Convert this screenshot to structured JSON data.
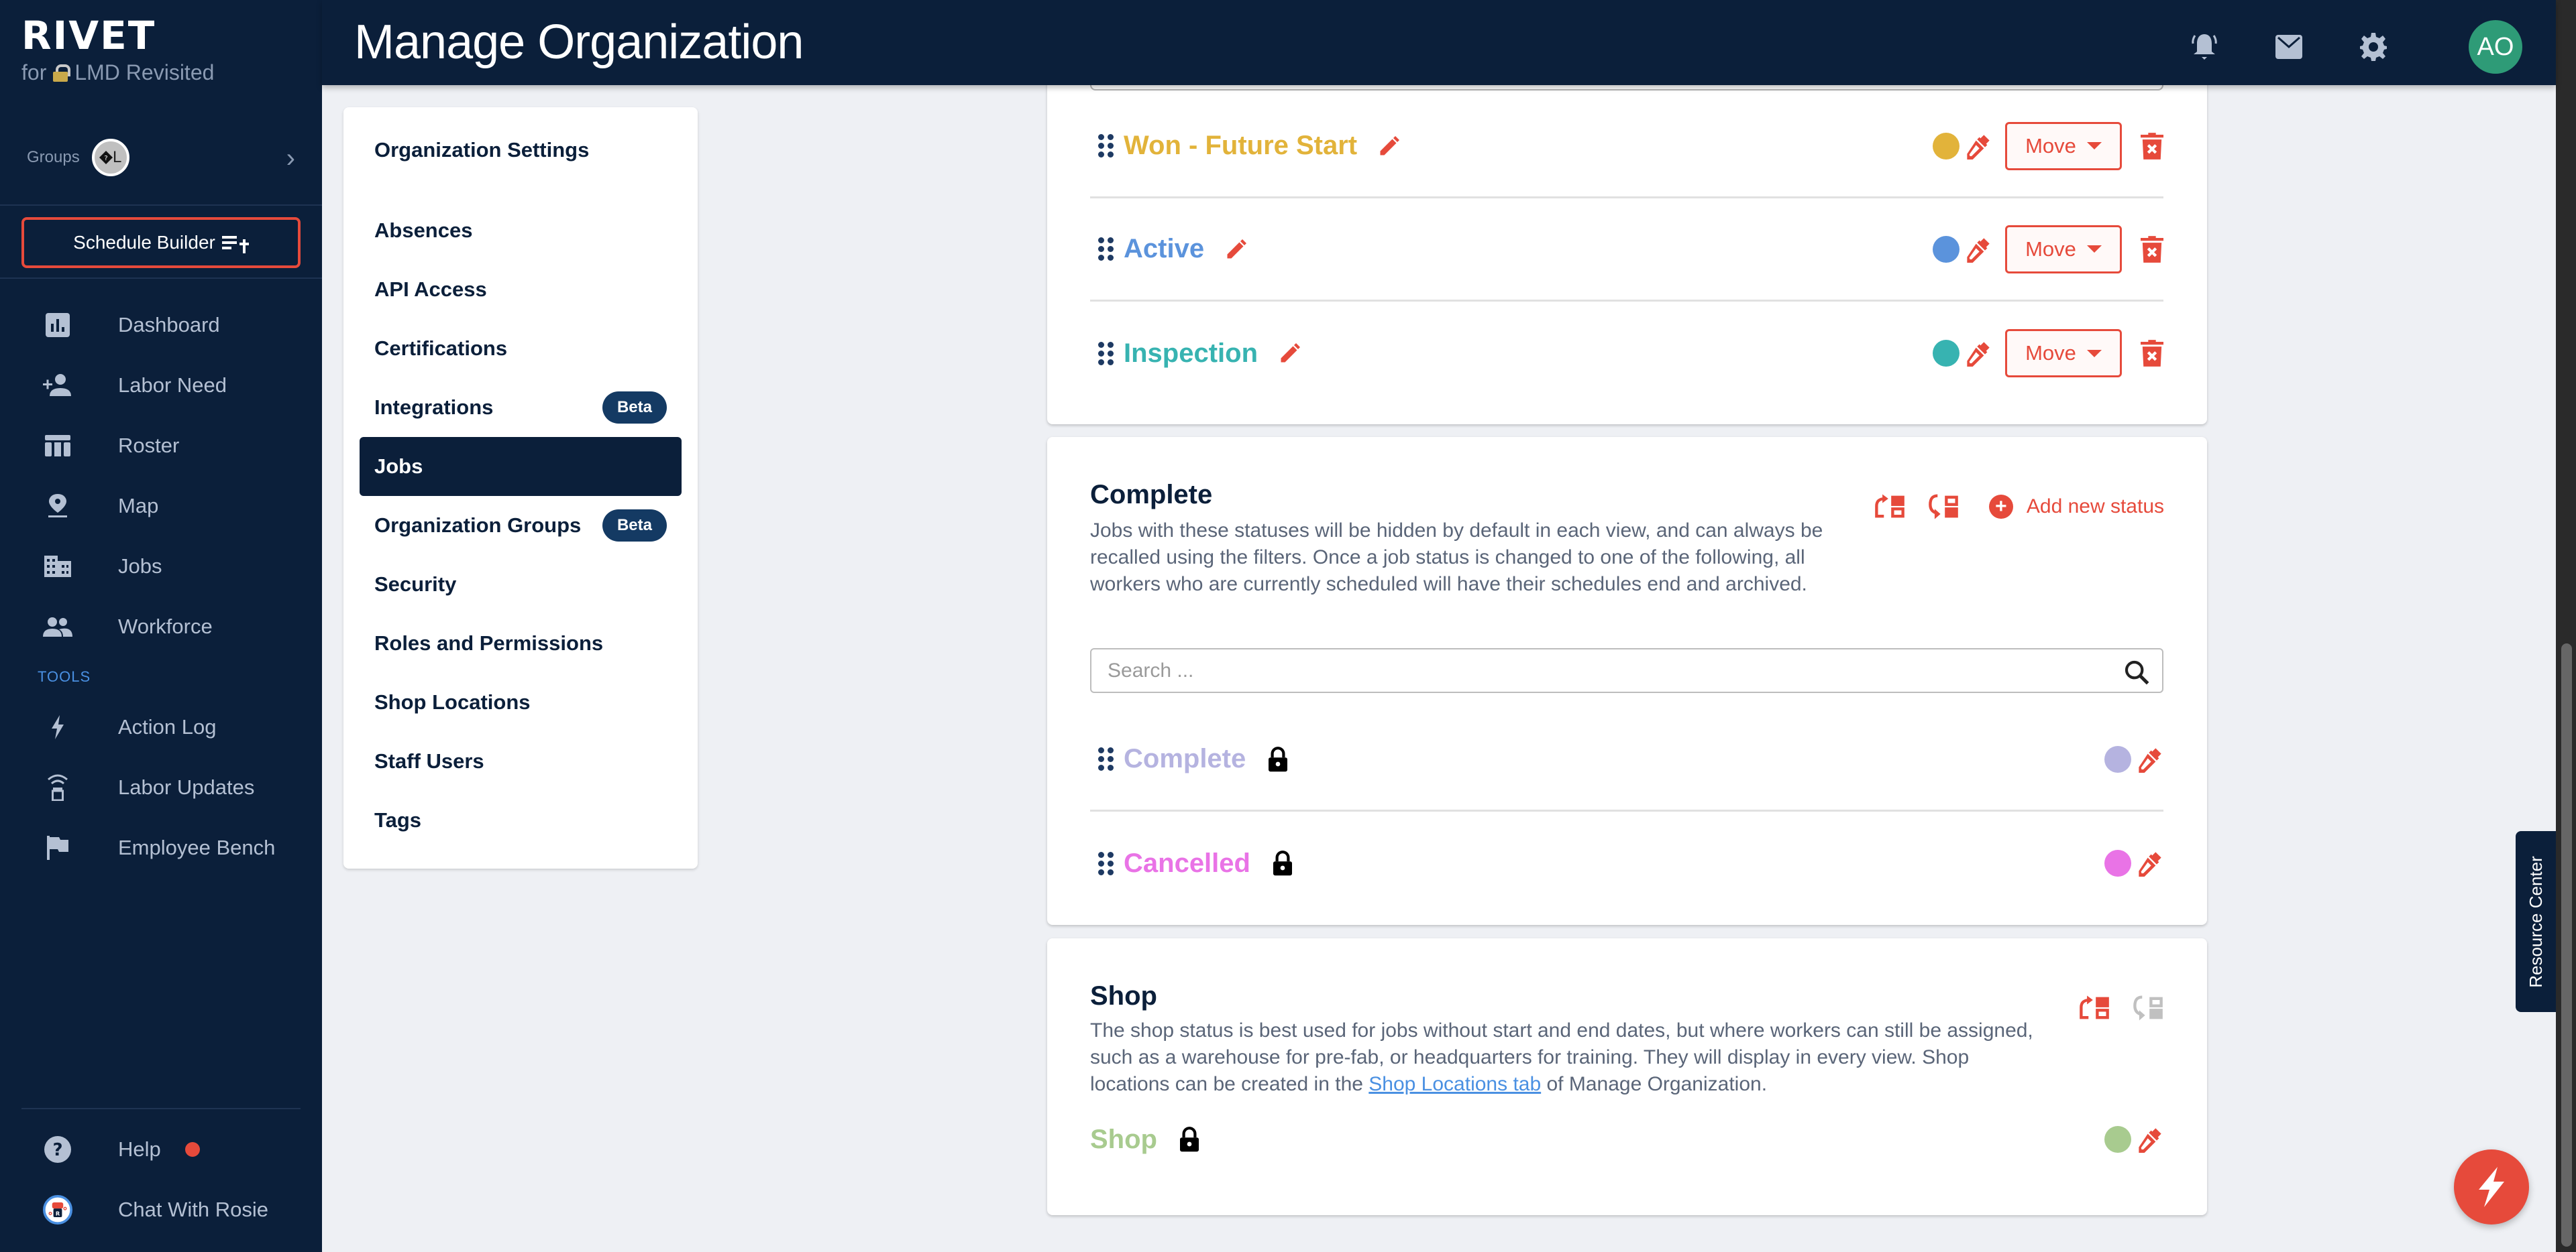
{
  "brand": {
    "name": "RIVET",
    "sub_prefix": "for",
    "org_name": "LMD Revisited"
  },
  "groups": {
    "label": "Groups",
    "avatar_text": "L"
  },
  "schedule_builder": {
    "label": "Schedule Builder"
  },
  "nav": {
    "main": [
      {
        "label": "Dashboard",
        "icon": "dashboard-icon"
      },
      {
        "label": "Labor Need",
        "icon": "person-add-icon"
      },
      {
        "label": "Roster",
        "icon": "table-icon"
      },
      {
        "label": "Map",
        "icon": "map-pin-icon"
      },
      {
        "label": "Jobs",
        "icon": "building-icon"
      },
      {
        "label": "Workforce",
        "icon": "people-icon"
      }
    ],
    "tools_heading": "TOOLS",
    "tools": [
      {
        "label": "Action Log",
        "icon": "bolt-icon"
      },
      {
        "label": "Labor Updates",
        "icon": "broadcast-icon"
      },
      {
        "label": "Employee Bench",
        "icon": "flag-icon"
      }
    ],
    "bottom": [
      {
        "label": "Help",
        "icon": "help-icon",
        "has_notification": true
      },
      {
        "label": "Chat With Rosie",
        "icon": "rosie-bot-icon"
      }
    ]
  },
  "header": {
    "title": "Manage Organization",
    "icons": [
      "notifications-icon",
      "mail-icon",
      "settings-icon"
    ],
    "avatar_initials": "AO"
  },
  "settings": {
    "title": "Organization Settings",
    "items": [
      {
        "label": "Absences"
      },
      {
        "label": "API Access"
      },
      {
        "label": "Certifications"
      },
      {
        "label": "Integrations",
        "badge": "Beta"
      },
      {
        "label": "Jobs",
        "active": true
      },
      {
        "label": "Organization Groups",
        "badge": "Beta"
      },
      {
        "label": "Security"
      },
      {
        "label": "Roles and Permissions"
      },
      {
        "label": "Shop Locations"
      },
      {
        "label": "Staff Users"
      },
      {
        "label": "Tags"
      }
    ]
  },
  "in_progress_section": {
    "statuses": [
      {
        "name": "Won - Future Start",
        "color": "#e2b33a",
        "move_label": "Move"
      },
      {
        "name": "Active",
        "color": "#5b93dc",
        "move_label": "Move"
      },
      {
        "name": "Inspection",
        "color": "#37b3b1",
        "move_label": "Move"
      }
    ]
  },
  "complete_section": {
    "title": "Complete",
    "description": "Jobs with these statuses will be hidden by default in each view, and can always be recalled using the filters. Once a job status is changed to one of the following, all workers who are currently scheduled will have their schedules end and archived.",
    "add_label": "Add new status",
    "search_placeholder": "Search ...",
    "statuses": [
      {
        "name": "Complete",
        "color": "#b5b3e0",
        "locked": true
      },
      {
        "name": "Cancelled",
        "color": "#e973e6",
        "locked": true
      }
    ]
  },
  "shop_section": {
    "title": "Shop",
    "description_before": "The shop status is best used for jobs without start and end dates, but where workers can still be assigned, such as a warehouse for pre-fab, or headquarters for training. They will display in every view. Shop locations can be created in the ",
    "link_text": "Shop Locations tab",
    "description_after": " of Manage Organization.",
    "statuses": [
      {
        "name": "Shop",
        "color": "#a8cb8f",
        "locked": true
      }
    ]
  },
  "resource_center": {
    "label": "Resource Center"
  },
  "colors": {
    "primary_dark": "#0b1f3a",
    "accent": "#e64a3b",
    "link": "#4a90e2"
  }
}
